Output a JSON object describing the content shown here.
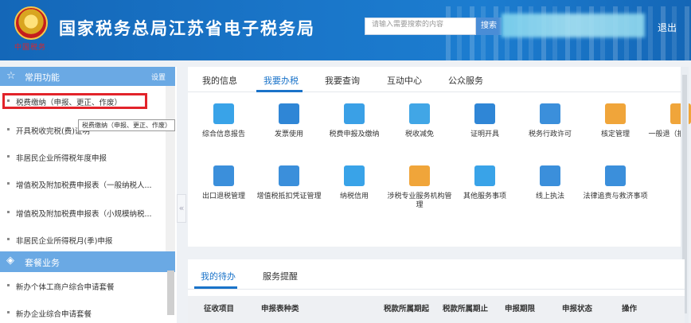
{
  "header": {
    "emblem_caption": "中国税务",
    "title": "国家税务总局江苏省电子税务局",
    "search_placeholder": "请输入需要搜索的内容",
    "search_button": "搜索",
    "logout": "退出"
  },
  "sidebar": {
    "common_title": "常用功能",
    "settings_label": "设置",
    "items": [
      "税费缴纳（申报、更正、作废）",
      "开具税收完税(费)证明",
      "非居民企业所得税年度申报",
      "增值税及附加税费申报表（一般纳税人...",
      "增值税及附加税费申报表（小规模纳税...",
      "非居民企业所得税月(季)申报"
    ],
    "tooltip": "税费缴纳（申报、更正、作废）",
    "package_title": "套餐业务",
    "package_items": [
      "新办个体工商户综合申请套餐",
      "新办企业综合申请套餐"
    ]
  },
  "main": {
    "tabs": [
      "我的信息",
      "我要办税",
      "我要查询",
      "互动中心",
      "公众服务"
    ],
    "active_tab": "我要办税",
    "grid_row1": [
      {
        "label": "综合信息报告",
        "icon": "report-icon",
        "color": "#39a3e8"
      },
      {
        "label": "发票使用",
        "icon": "invoice-icon",
        "color": "#2f86d6"
      },
      {
        "label": "税费申报及缴纳",
        "icon": "declare-icon",
        "color": "#3aa0e6"
      },
      {
        "label": "税收减免",
        "icon": "reduction-icon",
        "color": "#41a6e6"
      },
      {
        "label": "证明开具",
        "icon": "certificate-icon",
        "color": "#2f86d6"
      },
      {
        "label": "税务行政许可",
        "icon": "license-icon",
        "color": "#3b8fdb"
      },
      {
        "label": "核定管理",
        "icon": "shield-icon",
        "color": "#f0a53a"
      },
      {
        "label": "一般退（抵）税管理",
        "icon": "refund-icon",
        "color": "#f0a53a"
      }
    ],
    "grid_row2": [
      {
        "label": "出口退税管理",
        "icon": "export-refund-icon",
        "color": "#3b8fdb"
      },
      {
        "label": "增值税抵扣凭证管理",
        "icon": "vat-voucher-icon",
        "color": "#3b8fdb"
      },
      {
        "label": "纳税信用",
        "icon": "credit-icon",
        "color": "#39a3e8"
      },
      {
        "label": "涉税专业服务机构管理",
        "icon": "agency-icon",
        "color": "#f0a53a"
      },
      {
        "label": "其他服务事项",
        "icon": "other-service-icon",
        "color": "#39a3e8"
      },
      {
        "label": "线上执法",
        "icon": "online-law-icon",
        "color": "#3b8fdb"
      },
      {
        "label": "法律追责与救济事项",
        "icon": "legal-icon",
        "color": "#3b8fdb"
      }
    ]
  },
  "todo": {
    "tabs": [
      "我的待办",
      "服务提醒"
    ],
    "columns": [
      "征收项目",
      "申报表种类",
      "税款所属期起",
      "税款所属期止",
      "申报期限",
      "申报状态",
      "操作"
    ]
  },
  "colors": {
    "header_blue": "#1a76c9",
    "accent": "#1a73c9",
    "highlight_red": "#e2232a",
    "section_head": "#6aa9e4"
  }
}
